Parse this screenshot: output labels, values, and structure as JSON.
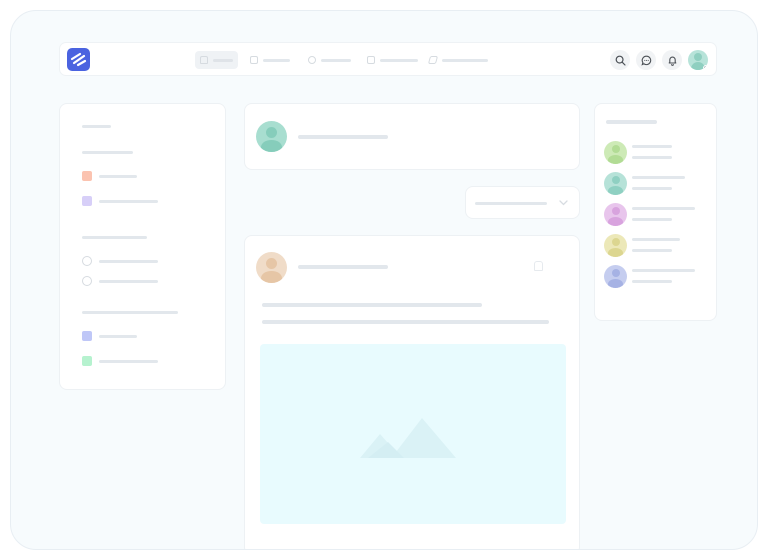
{
  "app": {
    "brand_color": "#4b63e0",
    "logo": "feather-stripes-logo"
  },
  "topbar": {
    "nav": [
      {
        "icon": "home-icon",
        "active": true
      },
      {
        "icon": "calendar-icon",
        "active": false
      },
      {
        "icon": "explore-icon",
        "active": false
      },
      {
        "icon": "groups-icon",
        "active": false
      },
      {
        "icon": "edit-icon",
        "active": false
      }
    ],
    "actions": [
      {
        "icon": "search-icon"
      },
      {
        "icon": "chat-icon"
      },
      {
        "icon": "bell-icon"
      }
    ],
    "profile": {
      "icon": "user-avatar",
      "status": "away"
    }
  },
  "sidebar_left": {
    "sections": [
      {
        "items": [
          {
            "icon": "orange-square",
            "color": "#fbc3b0"
          },
          {
            "icon": "purple-square",
            "color": "#d7cff8"
          }
        ]
      },
      {
        "items": [
          {
            "icon": "user-icon"
          },
          {
            "icon": "user-icon"
          }
        ]
      },
      {
        "items": [
          {
            "icon": "blue-square",
            "color": "#bfc7f7"
          },
          {
            "icon": "green-square",
            "color": "#b6f2cf"
          }
        ]
      }
    ]
  },
  "composer": {
    "avatar_color": "#a8ded0"
  },
  "feed_sort": {
    "icon": "chevron-down-icon"
  },
  "post": {
    "author_avatar_color": "#f0dcc8",
    "media": {
      "type": "image-placeholder",
      "color": "#e8fbfe"
    }
  },
  "sidebar_right": {
    "friends": [
      {
        "avatar_color": "#cdeab6"
      },
      {
        "avatar_color": "#b6e2d8"
      },
      {
        "avatar_color": "#e8c5ec"
      },
      {
        "avatar_color": "#ece8b8"
      },
      {
        "avatar_color": "#c5cdef"
      }
    ]
  }
}
